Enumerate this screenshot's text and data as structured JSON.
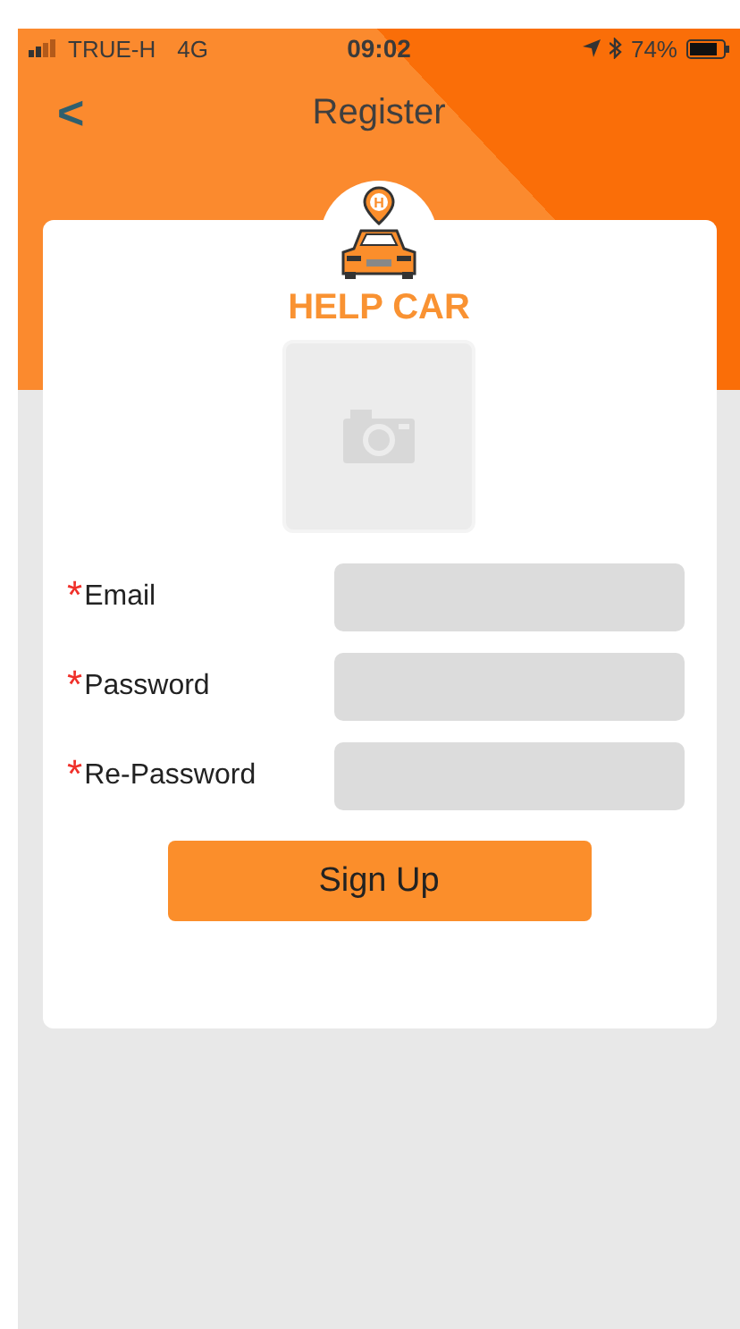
{
  "status_bar": {
    "carrier": "TRUE-H",
    "network": "4G",
    "time": "09:02",
    "battery": "74%"
  },
  "nav": {
    "back": "<",
    "title": "Register"
  },
  "logo": {
    "pin_letter": "H",
    "name": "HELP CAR"
  },
  "fields": [
    {
      "required_mark": "*",
      "label": "Email"
    },
    {
      "required_mark": "*",
      "label": "Password"
    },
    {
      "required_mark": "*",
      "label": "Re-Password"
    }
  ],
  "submit": "Sign Up"
}
